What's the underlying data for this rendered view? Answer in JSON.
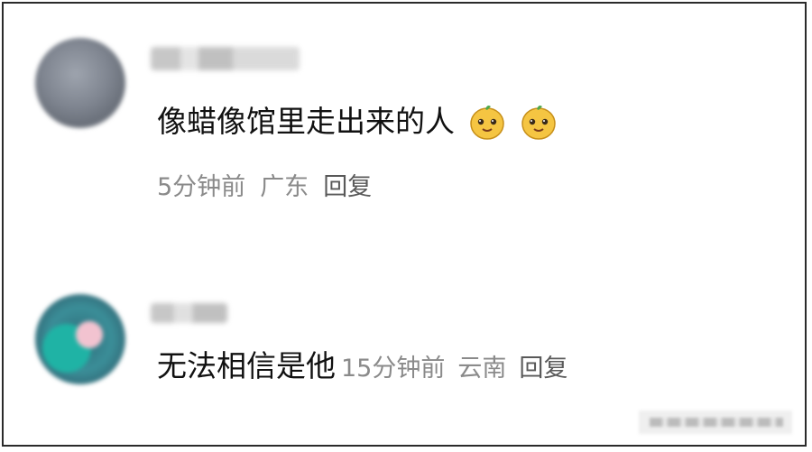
{
  "comments": [
    {
      "text": "像蜡像馆里走出来的人",
      "emoji_count": 2,
      "time": "5分钟前",
      "location": "广东",
      "reply": "回复"
    },
    {
      "text": "无法相信是他",
      "time": "15分钟前",
      "location": "云南",
      "reply": "回复"
    }
  ]
}
